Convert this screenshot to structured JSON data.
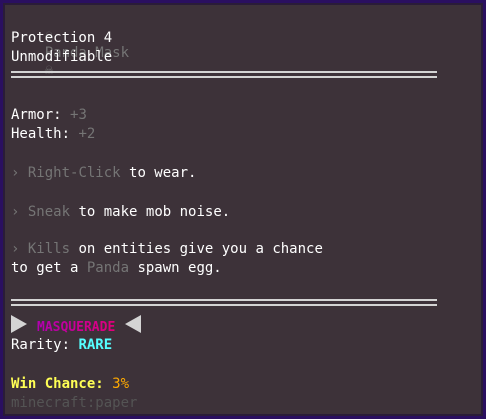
{
  "tooltip": {
    "title_icon": "skull-icon",
    "title": "Panda Mask",
    "enchant": "Protection 4",
    "unmodifiable": "Unmodifiable",
    "armor_label": "Armor:",
    "armor_value": "+3",
    "health_label": "Health:",
    "health_value": "+2",
    "bullet": "›",
    "line1_key": "Right-Click",
    "line1_rest": " to wear.",
    "line2_key": "Sneak",
    "line2_rest": " to make mob noise.",
    "line3_key": "Kills",
    "line3_rest": " on entities give you a chance",
    "line4_pre": "to get a ",
    "line4_key": "Panda",
    "line4_rest": " spawn egg.",
    "masquerade": "MASQUERADE",
    "rarity_label": "Rarity:",
    "rarity_value": "RARE",
    "win_label": "Win Chance:",
    "win_value": "3%",
    "item_id": "minecraft:paper",
    "colors": {
      "background": "#3d3239",
      "border": "#2a0f60",
      "muted": "#757575",
      "rarity": "#55ffff",
      "win_label": "#ffff55",
      "win_value": "#ffaa00",
      "masquerade": "#d0008c"
    }
  }
}
